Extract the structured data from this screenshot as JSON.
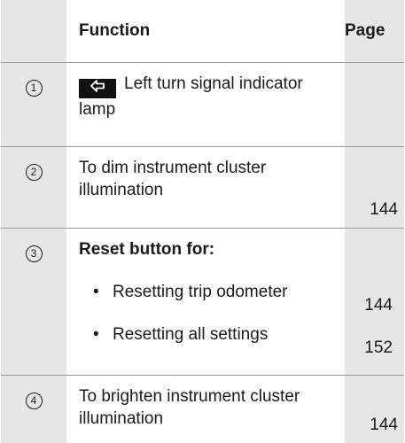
{
  "header": {
    "number": "",
    "function": "Function",
    "page": "Page"
  },
  "rows": [
    {
      "number": "1",
      "badge_icon": "left-arrow-icon",
      "function": "Left turn signal indicator lamp",
      "page": ""
    },
    {
      "number": "2",
      "function": "To dim instrument cluster illumination",
      "page": "144"
    },
    {
      "number": "3",
      "function": "Reset button for:",
      "bullet": "•",
      "items": [
        {
          "text": "Resetting trip odometer",
          "page": "144"
        },
        {
          "text": "Resetting all settings",
          "page": "152"
        }
      ]
    },
    {
      "number": "4",
      "function": "To brighten instrument cluster illumination",
      "page": "144"
    }
  ],
  "colors": {
    "shade": "#e6e6e6",
    "rule": "#9a9a9a",
    "badge": "#111111"
  }
}
